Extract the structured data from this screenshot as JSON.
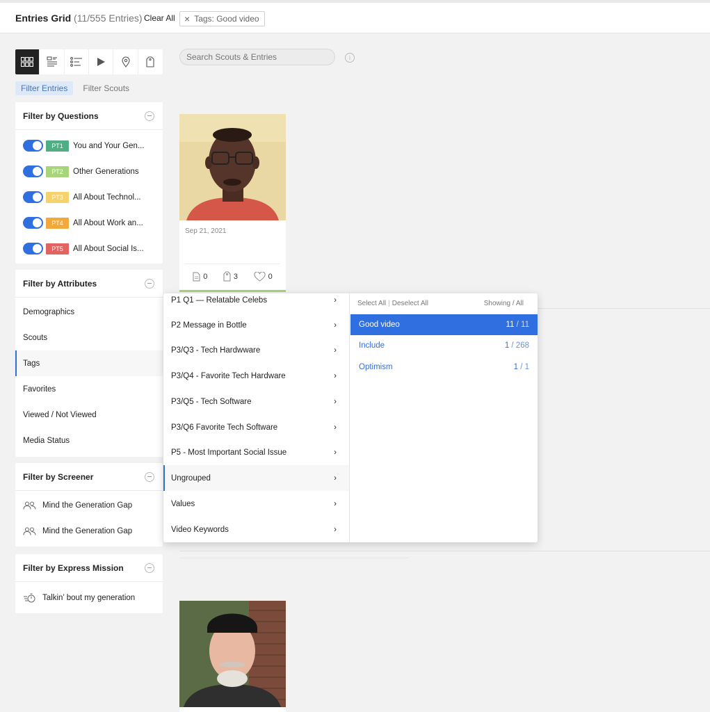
{
  "header": {
    "title": "Entries Grid",
    "count": "(11/555 Entries)",
    "clear_all": "Clear All",
    "chip_label": "Tags: Good video"
  },
  "view_toolbar": {
    "icons": [
      "grid-icon",
      "gallery-icon",
      "list-icon",
      "play-icon",
      "map-pin-icon",
      "tag-icon"
    ],
    "active": "grid-icon"
  },
  "filter_tabs": [
    "Filter Entries",
    "Filter Scouts"
  ],
  "questions": {
    "title": "Filter by Questions",
    "items": [
      {
        "badge": "PT1",
        "label": "You and Your Gen...",
        "color": "#4fae84"
      },
      {
        "badge": "PT2",
        "label": "Other Generations",
        "color": "#a8d57b"
      },
      {
        "badge": "PT3",
        "label": "All About Technol...",
        "color": "#f6d26d"
      },
      {
        "badge": "PT4",
        "label": "All About Work an...",
        "color": "#f2a93b"
      },
      {
        "badge": "PT5",
        "label": "All About Social Is...",
        "color": "#e26360"
      }
    ]
  },
  "attributes": {
    "title": "Filter by Attributes",
    "items": [
      "Demographics",
      "Scouts",
      "Tags",
      "Favorites",
      "Viewed / Not Viewed",
      "Media Status"
    ],
    "active": "Tags"
  },
  "screener": {
    "title": "Filter by Screener",
    "items": [
      "Mind the Generation Gap",
      "Mind the Generation Gap"
    ]
  },
  "express": {
    "title": "Filter by Express Mission",
    "items": [
      "Talkin’ bout my generation"
    ]
  },
  "search": {
    "placeholder": "Search Scouts & Entries",
    "info": "i"
  },
  "cards": [
    {
      "date": "Sep 21, 2021",
      "notes": "0",
      "tags": "3",
      "likes": "0"
    }
  ],
  "dropdown": {
    "groups": [
      "P1 Q1 — Relatable Celebs",
      "P2 Message in Bottle",
      "P3/Q3 - Tech Hardwware",
      "P3/Q4 - Favorite Tech Hardware",
      "P3/Q5 - Tech Software",
      "P3/Q6 Favorite Tech Software",
      "P5 - Most Important Social Issue",
      "Ungrouped",
      "Values",
      "Video Keywords"
    ],
    "active_group": "Ungrouped",
    "select_all": "Select All",
    "deselect_all": "Deselect All",
    "showing_all": "Showing / All",
    "tags": [
      {
        "label": "Good video",
        "shown": "11",
        "total": "/ 11",
        "selected": true
      },
      {
        "label": "Include",
        "shown": "1",
        "total": "/ 268",
        "selected": false
      },
      {
        "label": "Optimism",
        "shown": "1",
        "total": "/ 1",
        "selected": false
      }
    ]
  },
  "colors": {
    "accent": "#2f6fe0",
    "card_bar": "#a6d477"
  }
}
